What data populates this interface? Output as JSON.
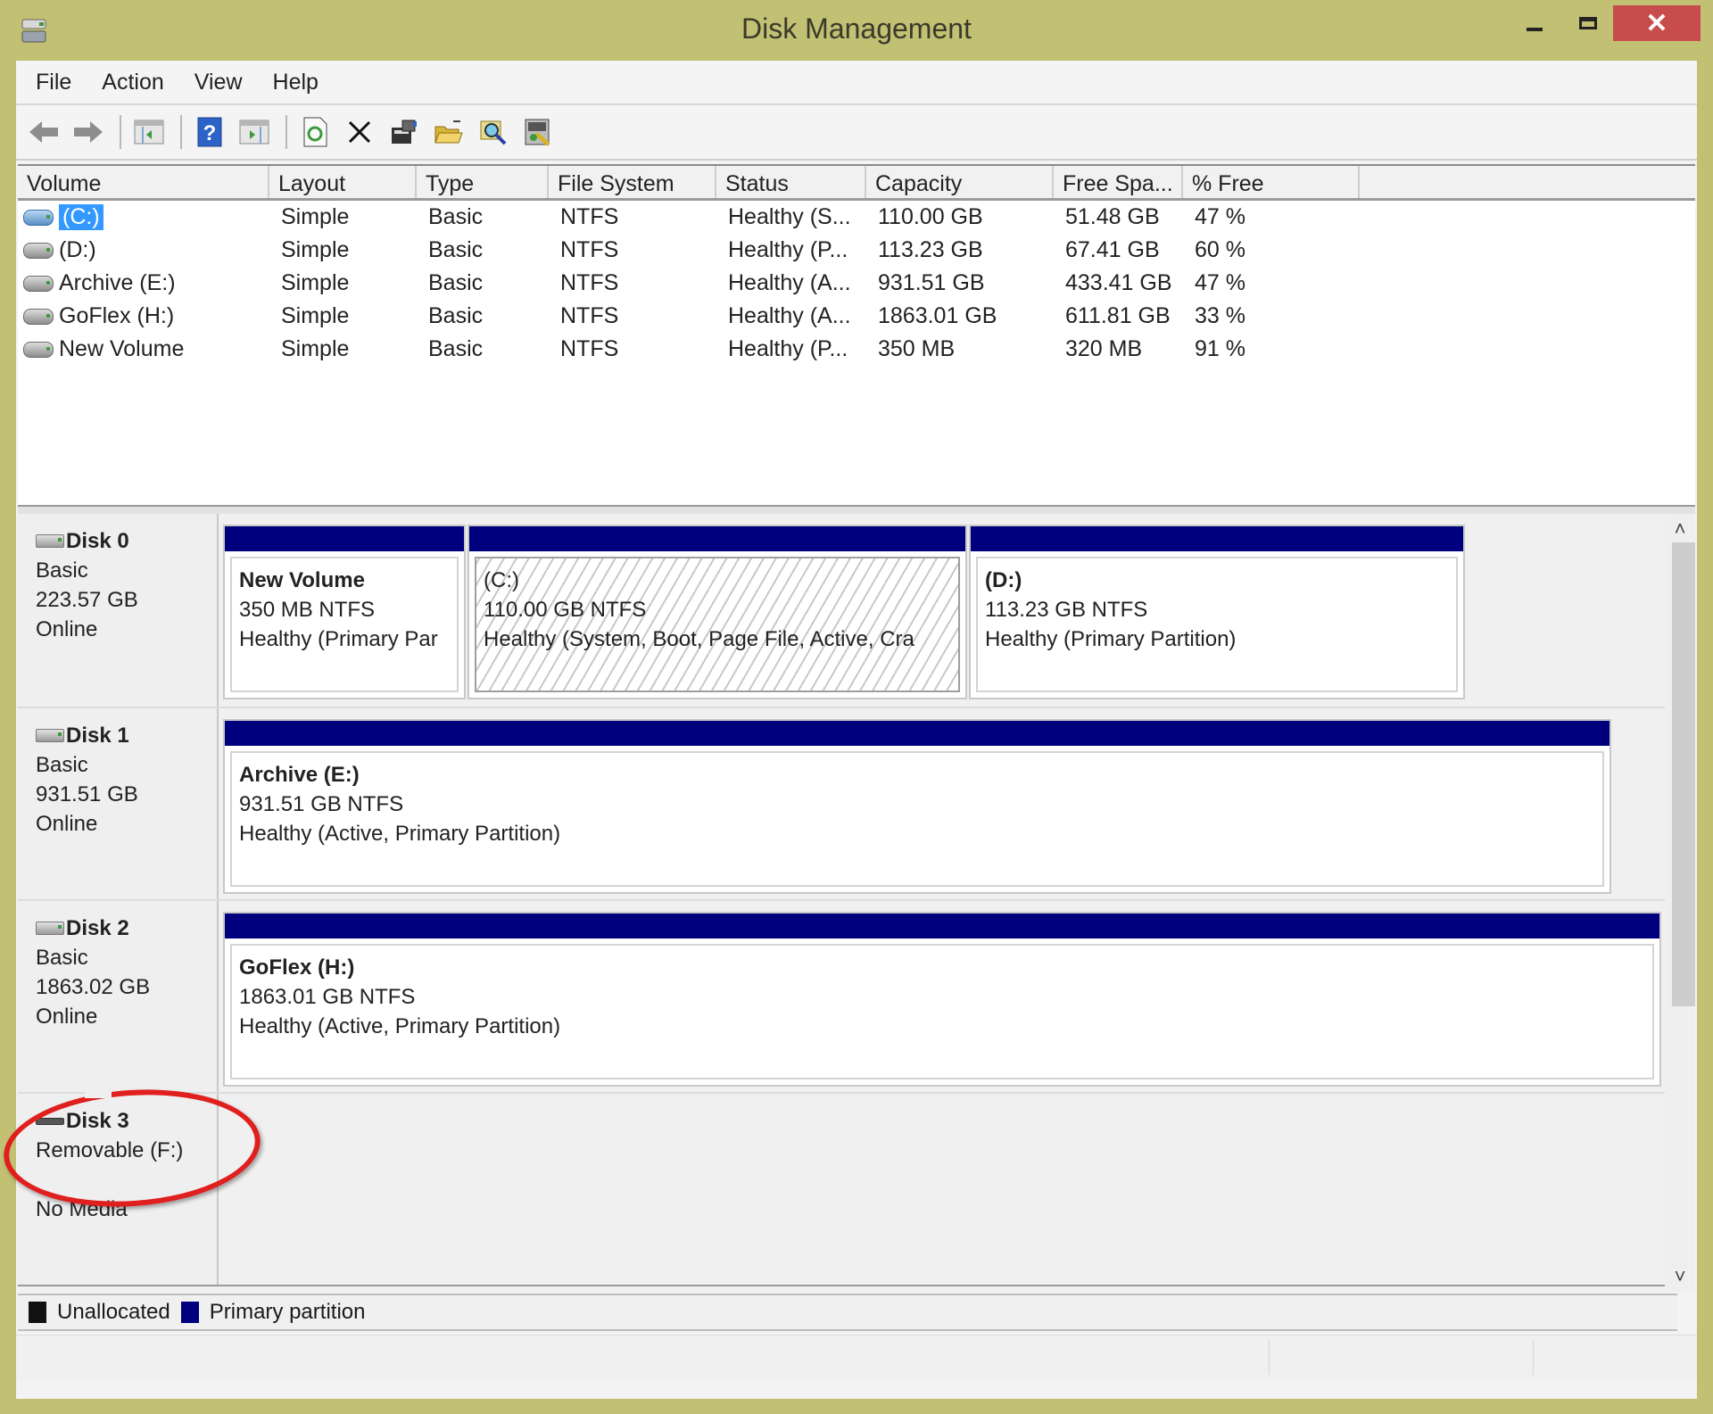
{
  "window": {
    "title": "Disk Management",
    "controls": {
      "minimize": "minimize",
      "maximize": "maximize",
      "close": "✕"
    }
  },
  "menu": [
    "File",
    "Action",
    "View",
    "Help"
  ],
  "toolbar": [
    {
      "name": "back-icon",
      "glyph": "⇦"
    },
    {
      "name": "forward-icon",
      "glyph": "⇨"
    },
    {
      "name": "show-hide-console-tree-icon",
      "glyph": "▤"
    },
    {
      "name": "help-icon",
      "glyph": "?"
    },
    {
      "name": "show-hide-action-pane-icon",
      "glyph": "▥"
    },
    {
      "name": "refresh-icon",
      "glyph": "⟳"
    },
    {
      "name": "delete-icon",
      "glyph": "✕"
    },
    {
      "name": "properties-icon",
      "glyph": "▦"
    },
    {
      "name": "open-icon",
      "glyph": "📂"
    },
    {
      "name": "explore-icon",
      "glyph": "🔍"
    },
    {
      "name": "settings-icon",
      "glyph": "⚙"
    }
  ],
  "volume_table": {
    "columns": [
      "Volume",
      "Layout",
      "Type",
      "File System",
      "Status",
      "Capacity",
      "Free Spa...",
      "% Free",
      ""
    ],
    "rows": [
      {
        "volume": "(C:)",
        "layout": "Simple",
        "type": "Basic",
        "fs": "NTFS",
        "status": "Healthy (S...",
        "capacity": "110.00 GB",
        "free": "51.48 GB",
        "pct": "47 %",
        "selected": true
      },
      {
        "volume": "(D:)",
        "layout": "Simple",
        "type": "Basic",
        "fs": "NTFS",
        "status": "Healthy (P...",
        "capacity": "113.23 GB",
        "free": "67.41 GB",
        "pct": "60 %"
      },
      {
        "volume": "Archive (E:)",
        "layout": "Simple",
        "type": "Basic",
        "fs": "NTFS",
        "status": "Healthy (A...",
        "capacity": "931.51 GB",
        "free": "433.41 GB",
        "pct": "47 %"
      },
      {
        "volume": "GoFlex (H:)",
        "layout": "Simple",
        "type": "Basic",
        "fs": "NTFS",
        "status": "Healthy (A...",
        "capacity": "1863.01 GB",
        "free": "611.81 GB",
        "pct": "33 %"
      },
      {
        "volume": "New Volume",
        "layout": "Simple",
        "type": "Basic",
        "fs": "NTFS",
        "status": "Healthy (P...",
        "capacity": "350 MB",
        "free": "320 MB",
        "pct": "91 %"
      }
    ]
  },
  "disks": [
    {
      "name": "Disk 0",
      "type": "Basic",
      "size": "223.57 GB",
      "state": "Online",
      "partitions": [
        {
          "name": "New Volume",
          "size": "350 MB NTFS",
          "status": "Healthy (Primary Par"
        },
        {
          "name": "(C:)",
          "size": "110.00 GB NTFS",
          "status": "Healthy (System, Boot, Page File, Active, Cra",
          "selected": true
        },
        {
          "name": "(D:)",
          "size": "113.23 GB NTFS",
          "status": "Healthy (Primary Partition)"
        }
      ]
    },
    {
      "name": "Disk 1",
      "type": "Basic",
      "size": "931.51 GB",
      "state": "Online",
      "partitions": [
        {
          "name": "Archive  (E:)",
          "size": "931.51 GB NTFS",
          "status": "Healthy (Active, Primary Partition)"
        }
      ]
    },
    {
      "name": "Disk 2",
      "type": "Basic",
      "size": "1863.02 GB",
      "state": "Online",
      "partitions": [
        {
          "name": "GoFlex  (H:)",
          "size": "1863.01 GB NTFS",
          "status": "Healthy (Active, Primary Partition)"
        }
      ]
    },
    {
      "name": "Disk 3",
      "type": "Removable (F:)",
      "state": "No Media",
      "partitions": []
    }
  ],
  "legend": [
    {
      "label": "Unallocated",
      "color": "#111111"
    },
    {
      "label": "Primary partition",
      "color": "#00007f"
    }
  ],
  "colors": {
    "title_bar": "#c2c073",
    "close_button": "#c94c4c",
    "partition_bar": "#00007f",
    "selection": "#3399ff",
    "annotation": "#e01f1f"
  }
}
